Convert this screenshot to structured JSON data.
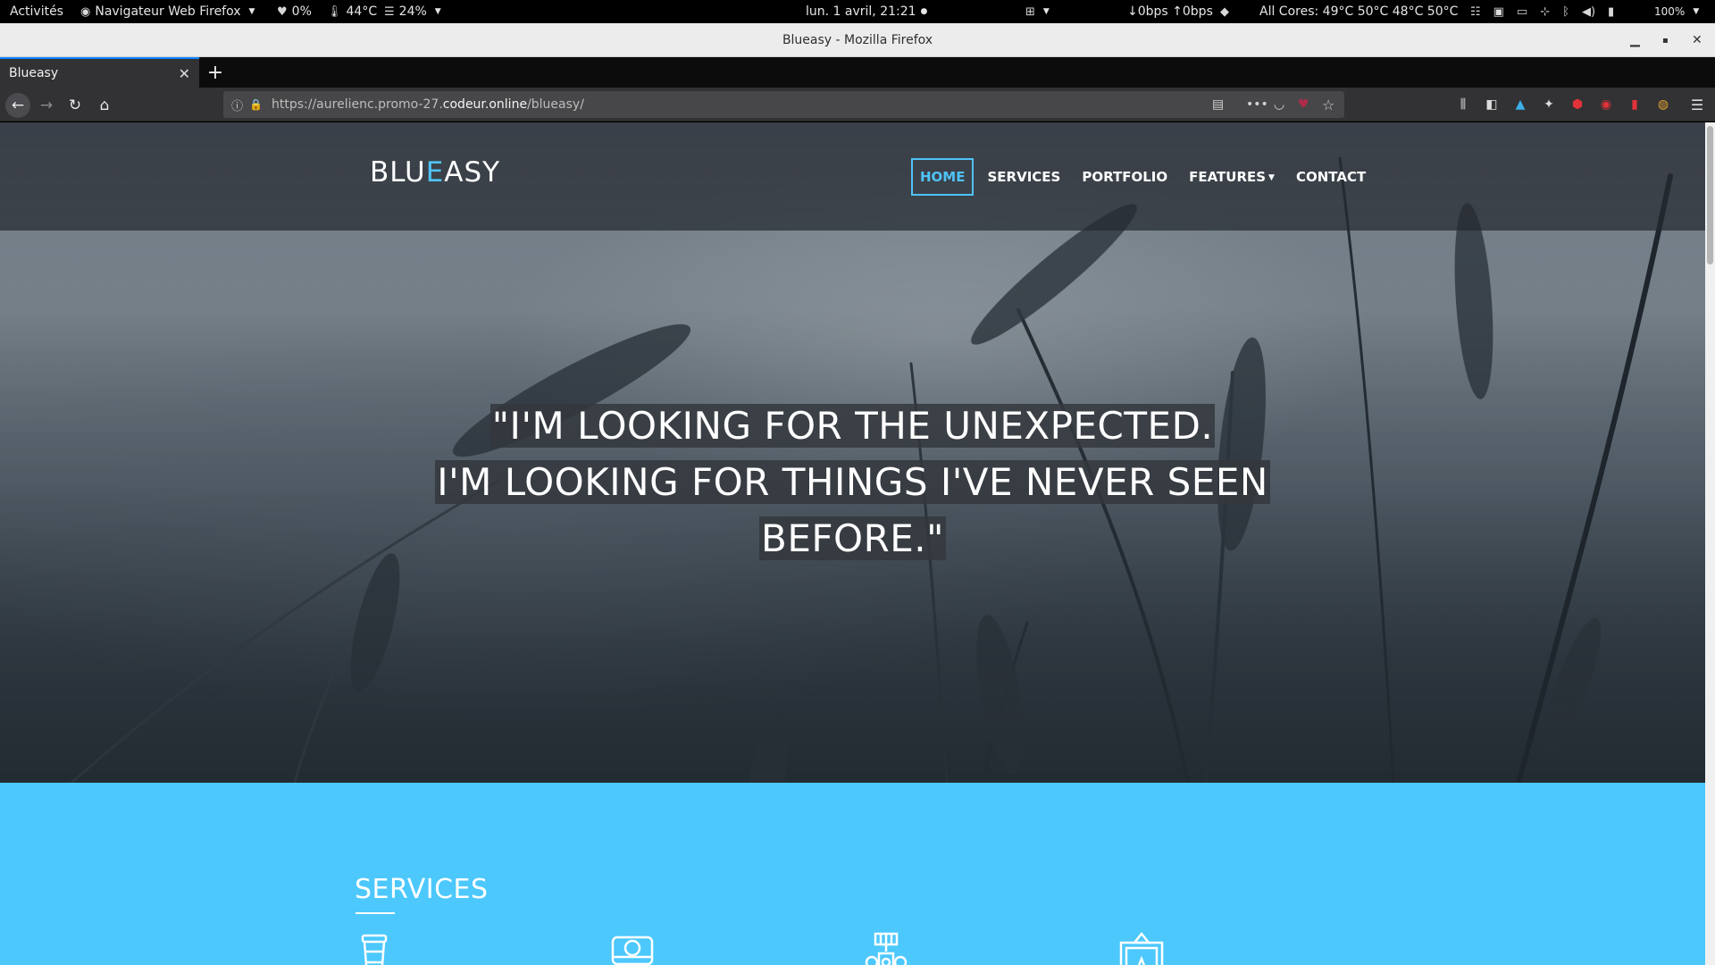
{
  "system_bar": {
    "activities": "Activités",
    "app_menu": "Navigateur Web Firefox",
    "cpu": "0%",
    "temp": "44°C",
    "disk": "24%",
    "datetime": "lun.  1 avril, 21:21",
    "net": "↓0bps ↑0bps",
    "cores": "All Cores: 49°C 50°C 48°C 50°C",
    "battery": "100%"
  },
  "window": {
    "title": "Blueasy - Mozilla Firefox"
  },
  "tab": {
    "title": "Blueasy",
    "close": "✕",
    "new_tab": "+"
  },
  "url": {
    "prefix": "https://aurelienc.promo-27.",
    "domain": "codeur.online",
    "path": "/blueasy/"
  },
  "site": {
    "logo_pre": "BLU",
    "logo_accent": "E",
    "logo_post": "ASY",
    "menu": [
      "HOME",
      "SERVICES",
      "PORTFOLIO",
      "FEATURES",
      "CONTACT"
    ],
    "quote_lines": [
      "\"I'M LOOKING FOR THE UNEXPECTED.",
      "I'M LOOKING FOR THINGS I'VE NEVER SEEN",
      "BEFORE.\""
    ],
    "services_title": "SERVICES"
  },
  "colors": {
    "accent": "#4fc3f7",
    "services_bg": "#4cc8fc",
    "tab_indicator": "#0a84ff"
  },
  "icons": [
    "heart-icon",
    "thermometer-icon",
    "database-icon",
    "back-icon",
    "forward-icon",
    "reload-icon",
    "home-icon",
    "info-icon",
    "lock-icon",
    "reader-view-icon",
    "more-icon",
    "pocket-icon",
    "star-icon",
    "library-icon",
    "sidebar-icon",
    "hamburger-menu-icon",
    "coffee-cup-icon",
    "camera-icon",
    "robot-icon",
    "picture-frame-icon"
  ]
}
